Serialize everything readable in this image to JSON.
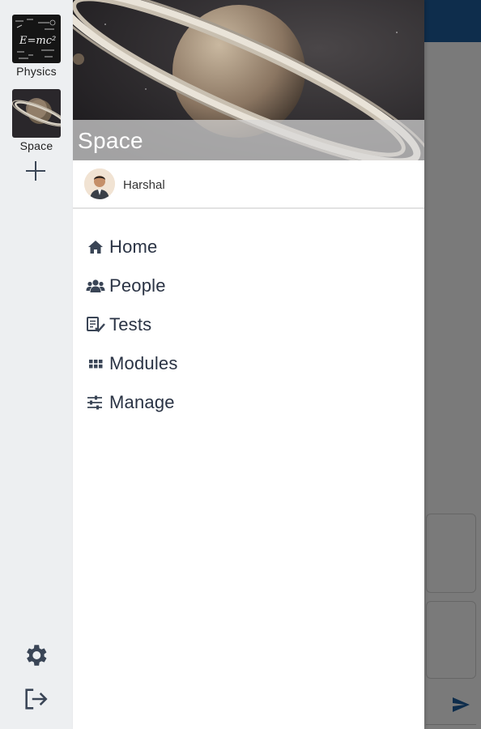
{
  "rail": {
    "courses": [
      {
        "label": "Physics",
        "thumb_text": "E=mc²"
      },
      {
        "label": "Space"
      }
    ],
    "add_icon": "plus-icon",
    "settings_icon": "gear-icon",
    "logout_icon": "logout-icon"
  },
  "drawer": {
    "banner_title": "Space",
    "user_name": "Harshal",
    "menu": [
      {
        "label": "Home",
        "icon": "home-icon"
      },
      {
        "label": "People",
        "icon": "people-icon"
      },
      {
        "label": "Tests",
        "icon": "tests-icon"
      },
      {
        "label": "Modules",
        "icon": "modules-icon"
      },
      {
        "label": "Manage",
        "icon": "sliders-icon"
      }
    ]
  },
  "colors": {
    "app_bar": "#1f5fa0",
    "rail_bg": "#edeff1",
    "menu_text": "#2a3344",
    "icon": "#3a4556"
  }
}
